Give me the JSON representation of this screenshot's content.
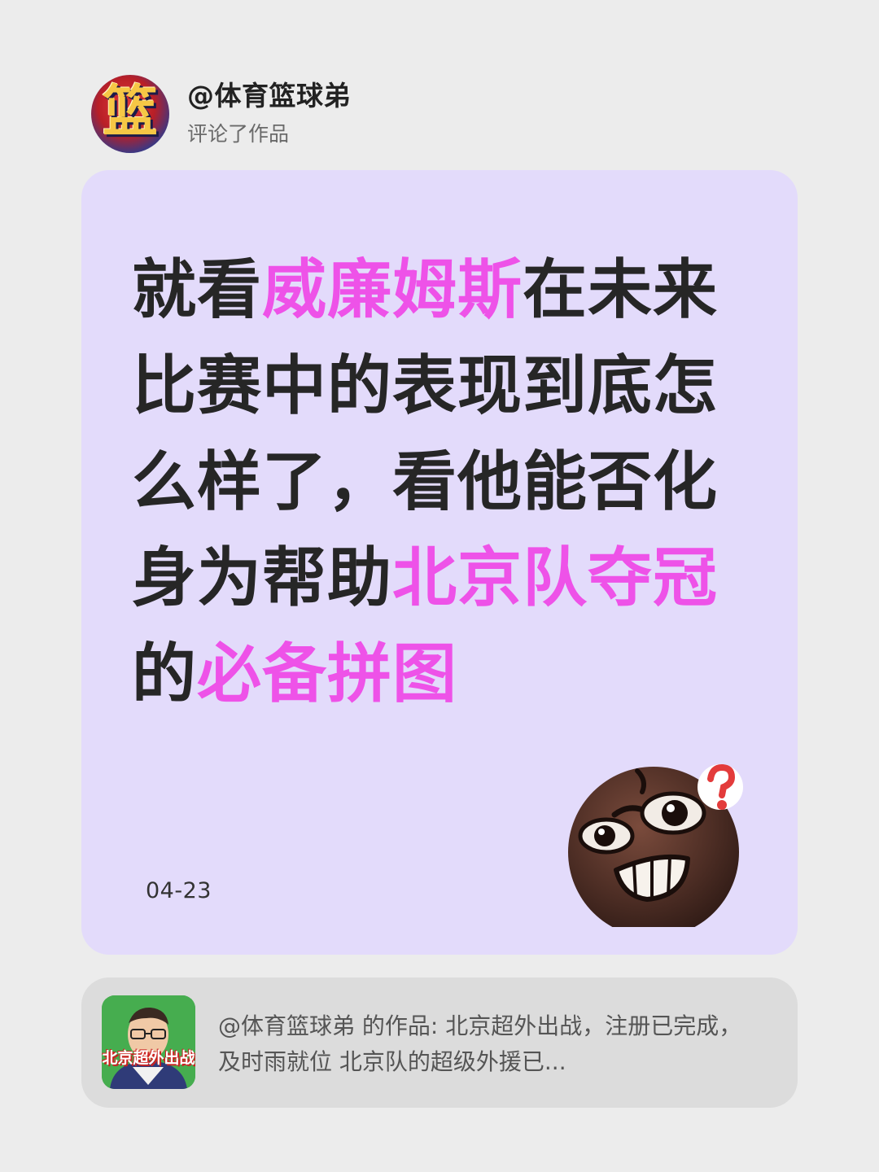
{
  "header": {
    "avatar_glyph": "篮",
    "username": "@体育篮球弟",
    "action": "评论了作品"
  },
  "comment": {
    "segments": [
      {
        "text": "就看",
        "highlight": false
      },
      {
        "text": "威廉姆斯",
        "highlight": true
      },
      {
        "text": "在未来比赛中的表现到底怎么样了，看他能否化身为帮助",
        "highlight": false
      },
      {
        "text": "北京队夺冠",
        "highlight": true
      },
      {
        "text": "的",
        "highlight": false
      },
      {
        "text": "必备拼图",
        "highlight": true
      }
    ],
    "date": "04-23",
    "emoji": "thinking-question-emoji"
  },
  "source": {
    "thumbnail_caption": "北京超外出战",
    "text": "@体育篮球弟 的作品: 北京超外出战，注册已完成，及时雨就位 北京队的超级外援已..."
  },
  "colors": {
    "background": "#ececec",
    "card": "#e3dbfb",
    "highlight": "#ee52e8",
    "source_card": "#dcdcdc"
  }
}
